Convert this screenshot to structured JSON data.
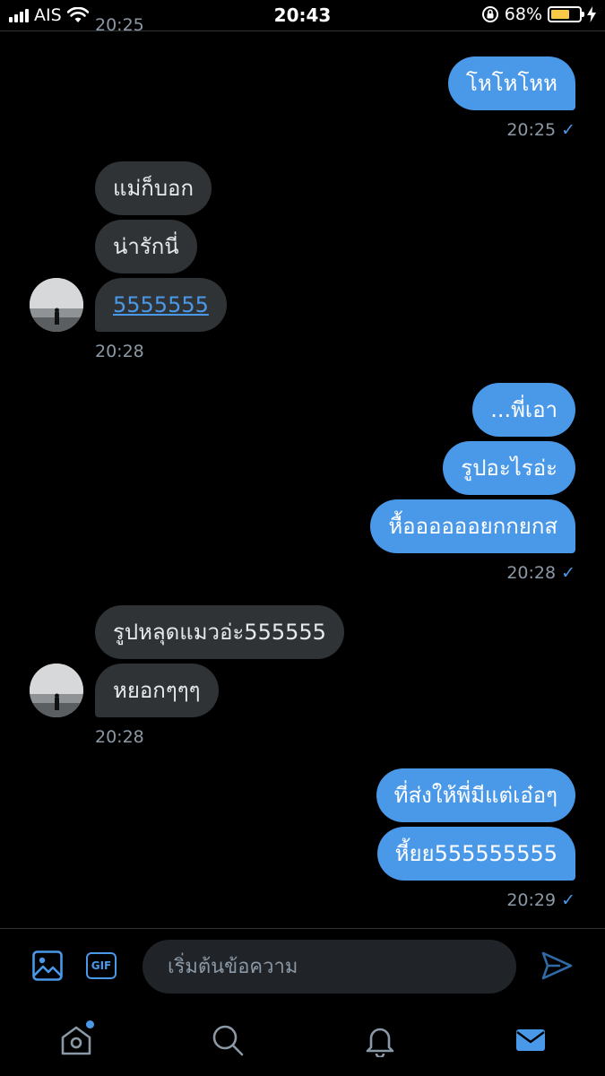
{
  "status_bar": {
    "carrier": "AIS",
    "time": "20:43",
    "battery_percent": "68%",
    "battery_level": 0.68
  },
  "conversation": {
    "clipped_timestamp": "20:25",
    "groups": [
      {
        "direction": "out",
        "messages": [
          "โหโหโหห"
        ],
        "time": "20:25"
      },
      {
        "direction": "in",
        "messages": [
          "แม่ก็บอก",
          "น่ารักนี่",
          "5555555"
        ],
        "time": "20:28"
      },
      {
        "direction": "out",
        "messages": [
          "...พี่เอา",
          "รูปอะไรอ่ะ",
          "หื้ออออออยกกยกส"
        ],
        "time": "20:28"
      },
      {
        "direction": "in",
        "messages": [
          "รูปหลุดแมวอ่ะ555555",
          "หยอกๆๆๆ"
        ],
        "time": "20:28"
      },
      {
        "direction": "out",
        "messages": [
          "ที่ส่งให้พี่มีแต่เอ๋อๆ",
          "หี้ยย555555555"
        ],
        "time": "20:29"
      }
    ]
  },
  "composer": {
    "placeholder": "เริ่มต้นข้อความ",
    "gif_label": "GIF"
  },
  "icons": {
    "image": "image-icon",
    "gif": "gif-icon",
    "send": "send-icon",
    "home": "home-icon",
    "search": "search-icon",
    "notifications": "bell-icon",
    "messages": "mail-icon"
  },
  "colors": {
    "accent": "#4a99e9",
    "incoming_bubble": "#2f3336",
    "background": "#000000",
    "muted_text": "#8b98a5"
  }
}
